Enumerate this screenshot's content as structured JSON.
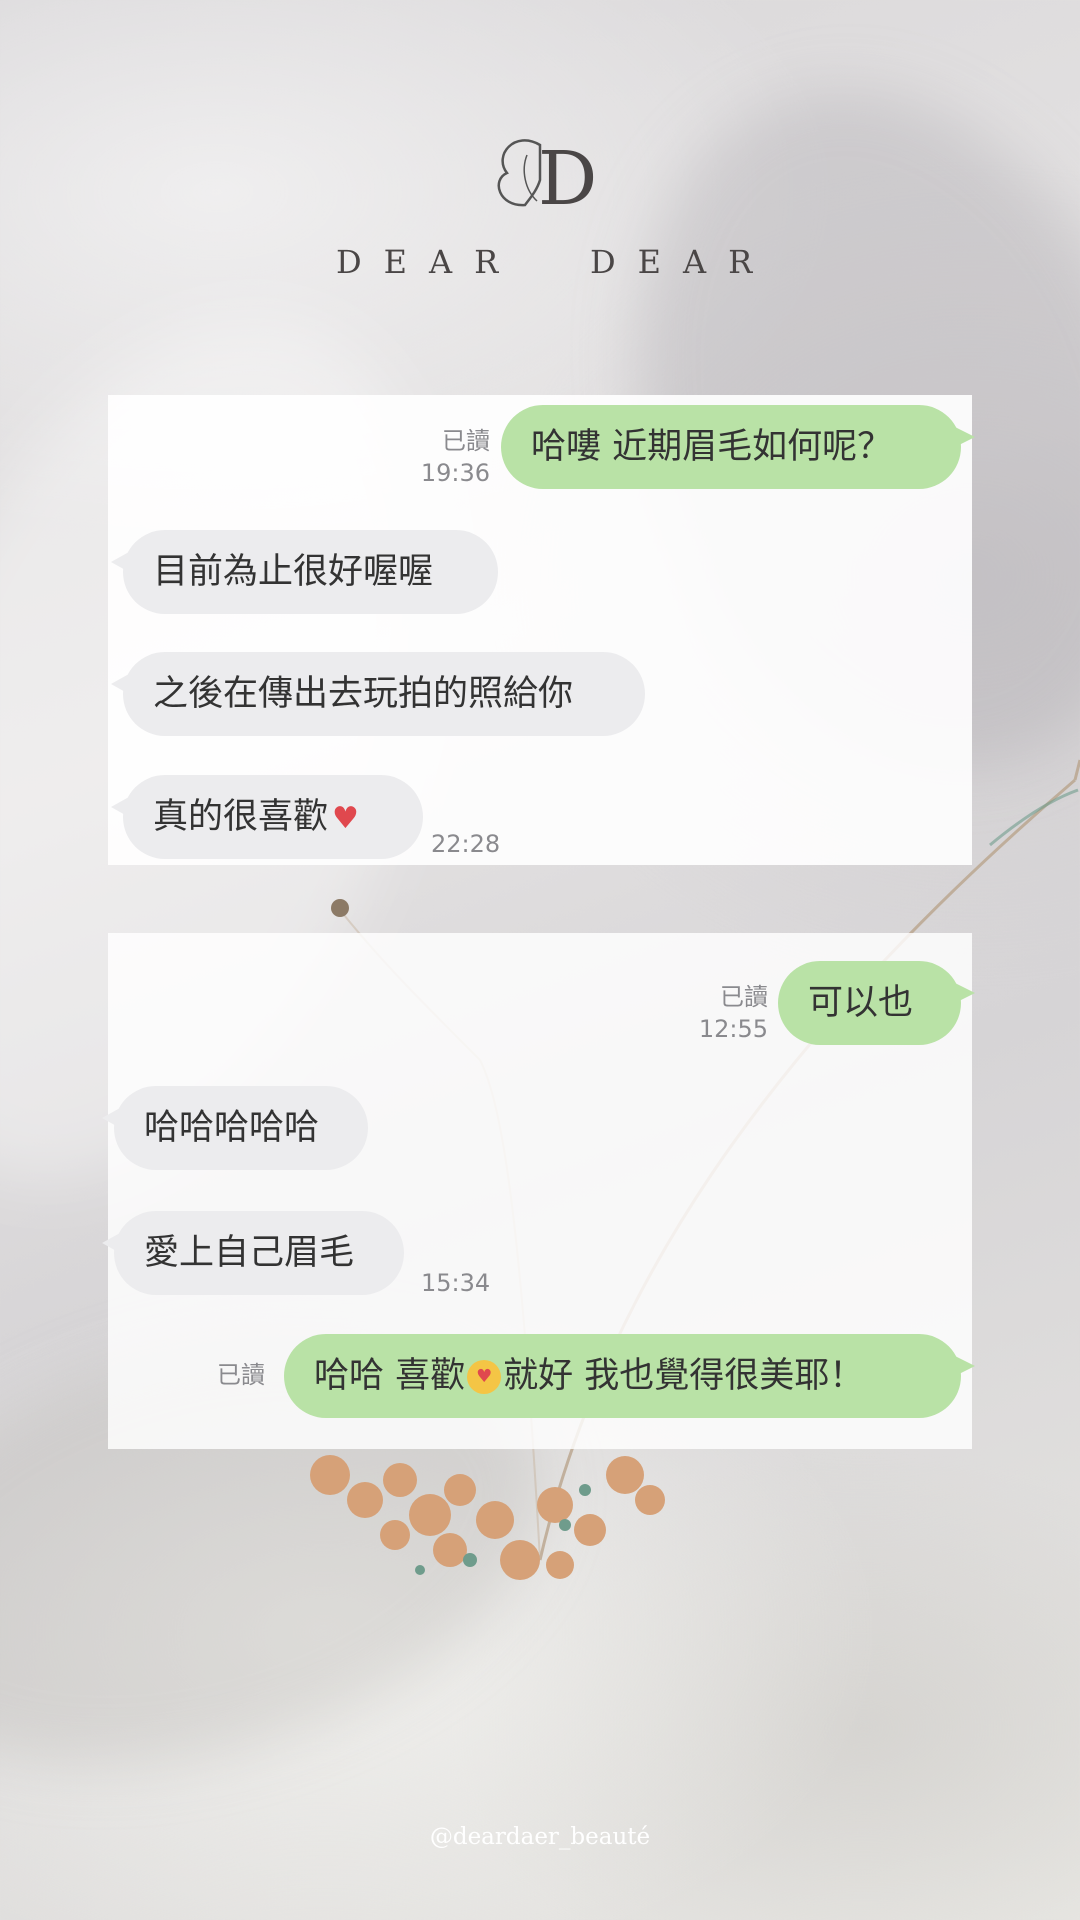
{
  "brand": {
    "logo_letter": "D",
    "name_left": "DEAR",
    "name_right": "DEAR",
    "handle": "@deardaer_beauté"
  },
  "chat1": {
    "sent_1": {
      "text": "哈嘍 近期眉毛如何呢？",
      "read": "已讀",
      "time": "19:36"
    },
    "recv_1": "目前為止很好喔喔",
    "recv_2": "之後在傳出去玩拍的照給你",
    "recv_3": "真的很喜歡",
    "recv_3_icon": "heart-icon",
    "recv_time": "22:28"
  },
  "chat2": {
    "sent_1": {
      "text": "可以也",
      "read": "已讀",
      "time": "12:55"
    },
    "recv_1": "哈哈哈哈哈",
    "recv_2": "愛上自己眉毛",
    "recv_time": "15:34",
    "sent_2": {
      "text_a": "哈哈 喜歡",
      "text_b": "就好 我也覺得很美耶！",
      "icon": "kissing-face-icon",
      "read": "已讀"
    }
  },
  "colors": {
    "sent_bubble": "#b9e2a6",
    "recv_bubble": "#ececee",
    "heart": "#e0484e"
  }
}
